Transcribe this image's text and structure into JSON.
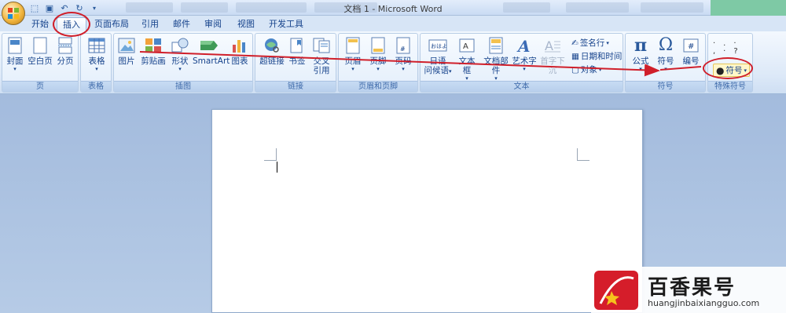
{
  "window": {
    "title": "文档 1 - Microsoft Word"
  },
  "tabs": [
    "开始",
    "插入",
    "页面布局",
    "引用",
    "邮件",
    "审阅",
    "视图",
    "开发工具"
  ],
  "active_tab": "插入",
  "groups": {
    "page": {
      "label": "页",
      "buttons": [
        "封面",
        "空白页",
        "分页"
      ]
    },
    "table": {
      "label": "表格",
      "buttons": [
        "表格"
      ]
    },
    "illustrations": {
      "label": "插图",
      "buttons": [
        "图片",
        "剪贴画",
        "形状",
        "SmartArt",
        "图表"
      ]
    },
    "links": {
      "label": "链接",
      "buttons": [
        "超链接",
        "书签",
        "交叉",
        "引用"
      ]
    },
    "header_footer": {
      "label": "页眉和页脚",
      "buttons": [
        "页眉",
        "页脚",
        "页码"
      ]
    },
    "text": {
      "label": "文本",
      "buttons": [
        "日语",
        "问候语",
        "文本框",
        "文档部件",
        "艺术字",
        "首字下沉"
      ],
      "side": [
        "签名行",
        "日期和时间",
        "对象"
      ]
    },
    "symbols": {
      "label": "符号",
      "buttons": [
        "公式",
        "符号",
        "编号"
      ]
    },
    "special": {
      "label": "特殊符号",
      "buttons": [
        "符号"
      ]
    }
  },
  "watermark": {
    "name": "百香果号",
    "url": "huangjinbaixiangguo.com"
  },
  "colors": {
    "annotation": "#d01f2a",
    "ribbon": "#dde9f8",
    "workspace": "#a4bbdc"
  }
}
